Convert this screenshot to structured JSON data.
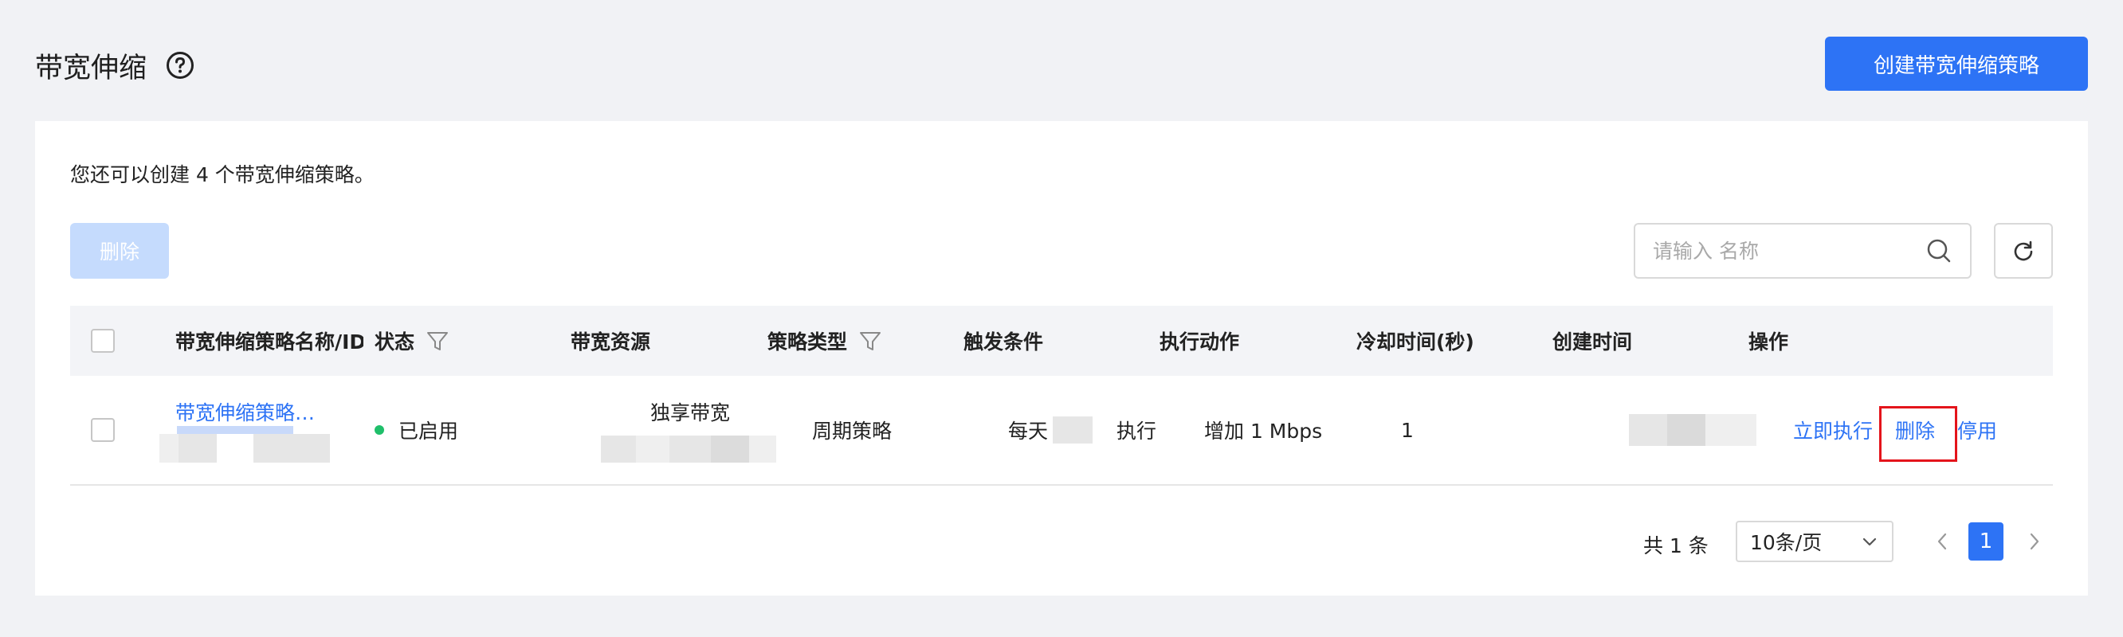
{
  "header": {
    "title": "带宽伸缩",
    "create_button": "创建带宽伸缩策略"
  },
  "card": {
    "info_text": "您还可以创建 4 个带宽伸缩策略。",
    "delete_button": "删除",
    "search": {
      "placeholder": "请输入 名称",
      "value": ""
    }
  },
  "table": {
    "columns": [
      "带宽伸缩策略名称/ID",
      "状态",
      "带宽资源",
      "策略类型",
      "触发条件",
      "执行动作",
      "冷却时间(秒)",
      "创建时间",
      "操作"
    ],
    "rows": [
      {
        "name": "带宽伸缩策略…",
        "status": "已启用",
        "bandwidth": "独享带宽",
        "policy_type": "周期策略",
        "trigger_prefix": "每天",
        "trigger_suffix": "执行",
        "action": "增加 1 Mbps",
        "cooldown": "1",
        "operations": [
          "立即执行",
          "删除",
          "停用"
        ]
      }
    ]
  },
  "pagination": {
    "total": "共 1 条",
    "page_size": "10条/页",
    "current_page": "1"
  },
  "colors": {
    "primary": "#2d73f5",
    "status_enabled": "#1fbf6a",
    "highlight_border": "#e4141b"
  }
}
